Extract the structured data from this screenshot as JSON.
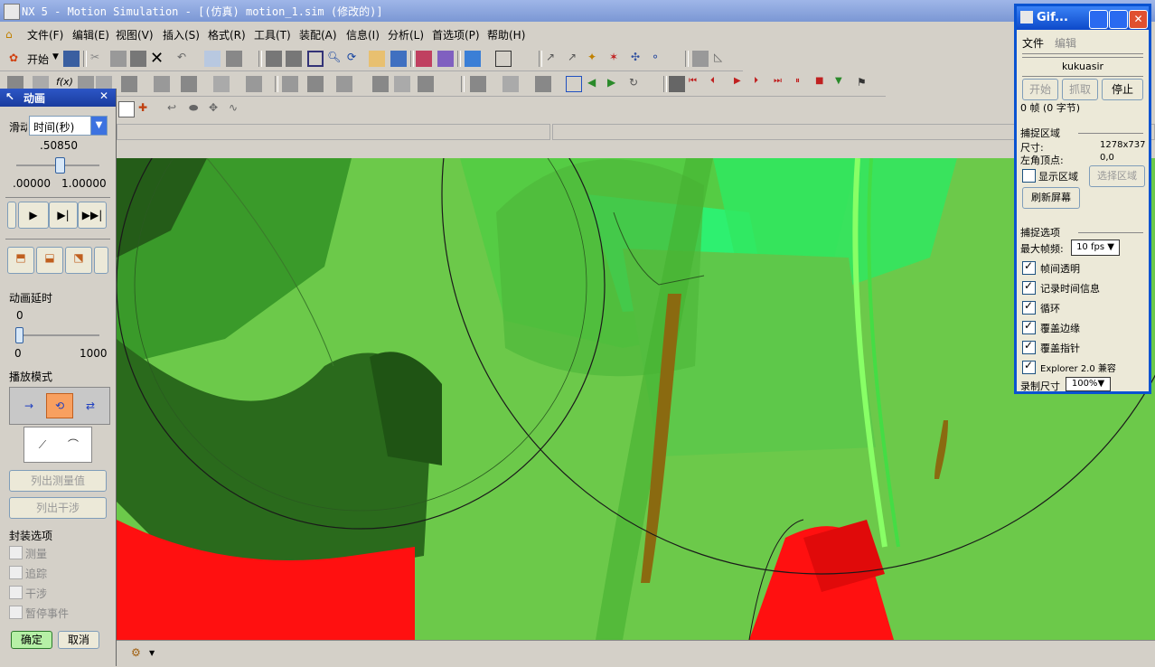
{
  "window": {
    "title": "NX 5 - Motion Simulation - [(仿真) motion_1.sim (修改的)]"
  },
  "menu": [
    "文件(F)",
    "编辑(E)",
    "视图(V)",
    "插入(S)",
    "格式(R)",
    "工具(T)",
    "装配(A)",
    "信息(I)",
    "分析(L)",
    "首选项(P)",
    "帮助(H)"
  ],
  "toolbar": {
    "start_label": "开始"
  },
  "anim_panel": {
    "title": "动画",
    "slider_label": "滑动",
    "unit_option": "时间(秒)",
    "current_value": ".50850",
    "range_min": ".00000",
    "range_max": "1.00000",
    "slider_level": 0.5085,
    "delay_label": "动画延时",
    "delay_value": "0",
    "delay_min": "0",
    "delay_max": "1000",
    "delay_level": 0,
    "play_mode_label": "播放模式",
    "list_measure_label": "列出测量值",
    "list_interference_label": "列出干涉",
    "envelope_label": "封装选项",
    "opt_measure": "测量",
    "opt_trace": "追踪",
    "opt_interference": "干涉",
    "opt_pause_event": "暂停事件",
    "ok_label": "确定",
    "cancel_label": "取消"
  },
  "gif_window": {
    "title": "Gif...",
    "menu_file": "文件",
    "menu_edit": "编辑",
    "name_field": "kukuasir",
    "btn_start": "开始",
    "btn_capture": "抓取",
    "btn_stop": "停止",
    "frame_info": "0 帧 (0 字节)",
    "capture_area_title": "捕捉区域",
    "size_label": "尺寸:",
    "size_value": "1278x737",
    "corner_label": "左角顶点:",
    "corner_value": "0,0",
    "show_area_label": "显示区域",
    "select_area_label": "选择区域",
    "refresh_label": "刷新屏幕",
    "capture_opts_title": "捕捉选项",
    "max_fps_label": "最大帧频:",
    "max_fps_value": "10 fps",
    "opt_transparent": "帧间透明",
    "opt_record_time": "记录时间信息",
    "opt_loop": "循环",
    "opt_cover_edge": "覆盖边缘",
    "opt_cover_pointer": "覆盖指针",
    "opt_explorer": "Explorer 2.0 兼容",
    "record_size_label": "录制尺寸",
    "record_size_value": "100%"
  },
  "colors": {
    "viewport_green": "#6cc94a",
    "part_red": "#ff1010",
    "title_blue": "#0a53d1"
  }
}
